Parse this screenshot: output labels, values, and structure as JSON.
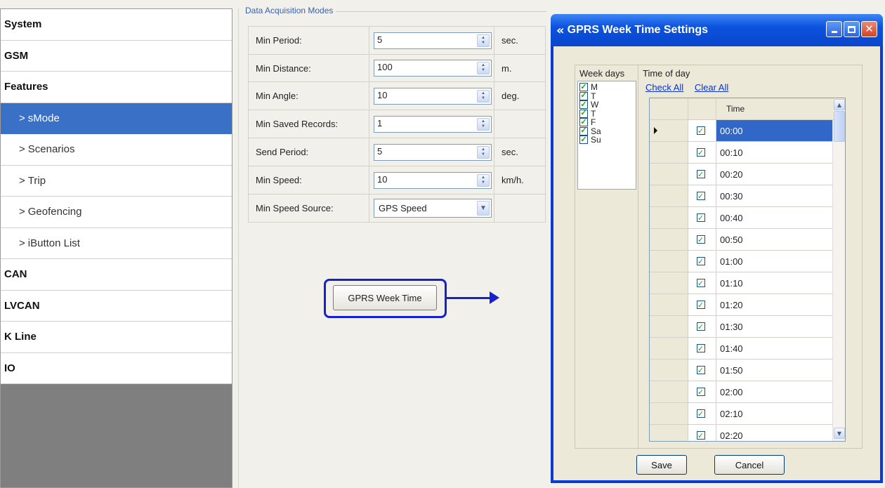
{
  "nav": {
    "items": [
      {
        "label": "System",
        "level": 0
      },
      {
        "label": "GSM",
        "level": 0
      },
      {
        "label": "Features",
        "level": 0
      },
      {
        "label": "sMode",
        "level": 1,
        "active": true
      },
      {
        "label": "Scenarios",
        "level": 1
      },
      {
        "label": "Trip",
        "level": 1
      },
      {
        "label": "Geofencing",
        "level": 1
      },
      {
        "label": "iButton List",
        "level": 1
      },
      {
        "label": "CAN",
        "level": 0
      },
      {
        "label": "LVCAN",
        "level": 0
      },
      {
        "label": "K Line",
        "level": 0
      },
      {
        "label": "IO",
        "level": 0
      }
    ],
    "sub_prefix": ">"
  },
  "acquisition": {
    "title": "Data Acquisition Modes",
    "rows": [
      {
        "label": "Min Period:",
        "value": "5",
        "unit": "sec."
      },
      {
        "label": "Min Distance:",
        "value": "100",
        "unit": "m."
      },
      {
        "label": "Min Angle:",
        "value": "10",
        "unit": "deg."
      },
      {
        "label": "Min Saved Records:",
        "value": "1",
        "unit": ""
      },
      {
        "label": "Send Period:",
        "value": "5",
        "unit": "sec."
      },
      {
        "label": "Min Speed:",
        "value": "10",
        "unit": "km/h."
      }
    ],
    "speed_source": {
      "label": "Min Speed Source:",
      "value": "GPS Speed"
    },
    "gprs_button": "GPRS Week Time"
  },
  "dialog": {
    "title": "GPRS Week Time Settings",
    "week_days_header": "Week days",
    "time_of_day_header": "Time of day",
    "week_days": [
      {
        "label": "M",
        "checked": true
      },
      {
        "label": "T",
        "checked": true
      },
      {
        "label": "W",
        "checked": true
      },
      {
        "label": "T",
        "checked": true
      },
      {
        "label": "F",
        "checked": true
      },
      {
        "label": "Sa",
        "checked": true
      },
      {
        "label": "Su",
        "checked": true
      }
    ],
    "check_all": "Check All",
    "clear_all": "Clear All",
    "grid_header": "Time",
    "times": [
      "00:00",
      "00:10",
      "00:20",
      "00:30",
      "00:40",
      "00:50",
      "01:00",
      "01:10",
      "01:20",
      "01:30",
      "01:40",
      "01:50",
      "02:00",
      "02:10",
      "02:20"
    ],
    "selected_index": 0,
    "save": "Save",
    "cancel": "Cancel"
  },
  "colors": {
    "nav_active": "#3a70c6",
    "dialog_title": "#0b52de",
    "highlight": "#1621cf",
    "grid_selection": "#3167c8",
    "check": "#21a121"
  }
}
